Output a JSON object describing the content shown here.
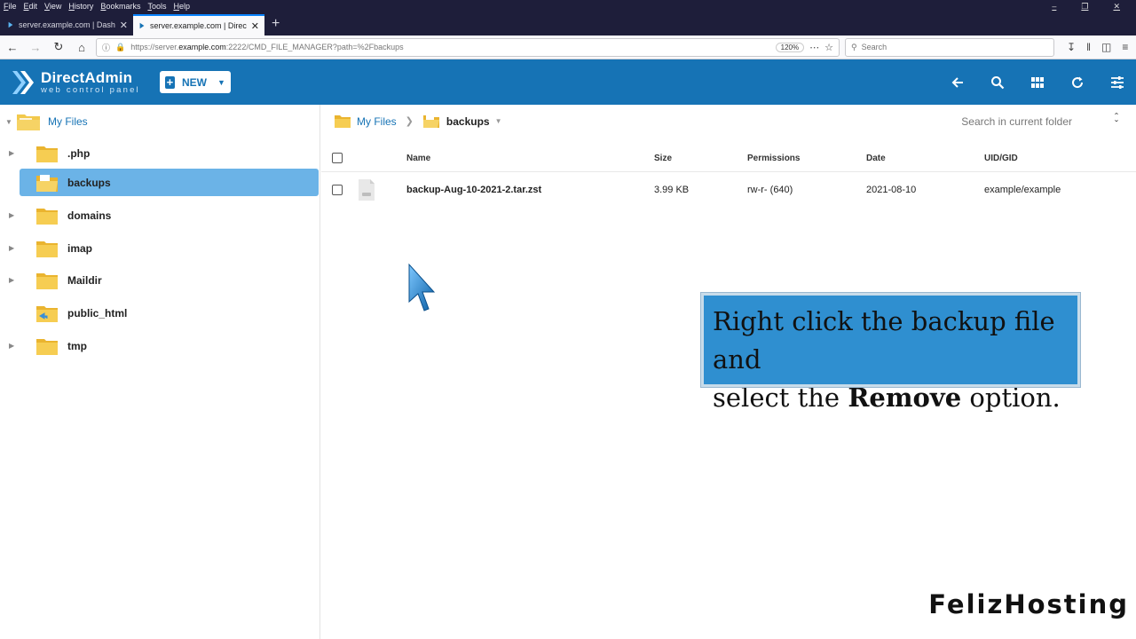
{
  "browser": {
    "menu": [
      "File",
      "Edit",
      "View",
      "History",
      "Bookmarks",
      "Tools",
      "Help"
    ],
    "tabs": [
      {
        "title": "server.example.com | Dashboard"
      },
      {
        "title": "server.example.com | DirectAdmin"
      }
    ],
    "url_prefix": "https://server.",
    "url_host": "example.com",
    "url_rest": ":2222/CMD_FILE_MANAGER?path=%2Fbackups",
    "zoom": "120%",
    "search_placeholder": "Search"
  },
  "app": {
    "brand_name": "DirectAdmin",
    "brand_sub": "web control panel",
    "new_label": "NEW",
    "accent": "#1673b5"
  },
  "tree": {
    "root_label": "My Files",
    "items": [
      {
        "label": ".php"
      },
      {
        "label": "backups"
      },
      {
        "label": "domains"
      },
      {
        "label": "imap"
      },
      {
        "label": "Maildir"
      },
      {
        "label": "public_html"
      },
      {
        "label": "tmp"
      }
    ]
  },
  "main": {
    "breadcrumb_root": "My Files",
    "breadcrumb_current": "backups",
    "folder_search_placeholder": "Search in current folder",
    "columns": {
      "name": "Name",
      "size": "Size",
      "permissions": "Permissions",
      "date": "Date",
      "uid": "UID/GID"
    },
    "rows": [
      {
        "name": "backup-Aug-10-2021-2.tar.zst",
        "size": "3.99 KB",
        "permissions": "rw-r- (640)",
        "date": "2021-08-10",
        "uid": "example/example"
      }
    ]
  },
  "overlay": {
    "line1": "Right click the backup file and",
    "line2_pre": "select the ",
    "line2_bold": "Remove",
    "line2_post": " option."
  },
  "watermark": "FelizHosting"
}
